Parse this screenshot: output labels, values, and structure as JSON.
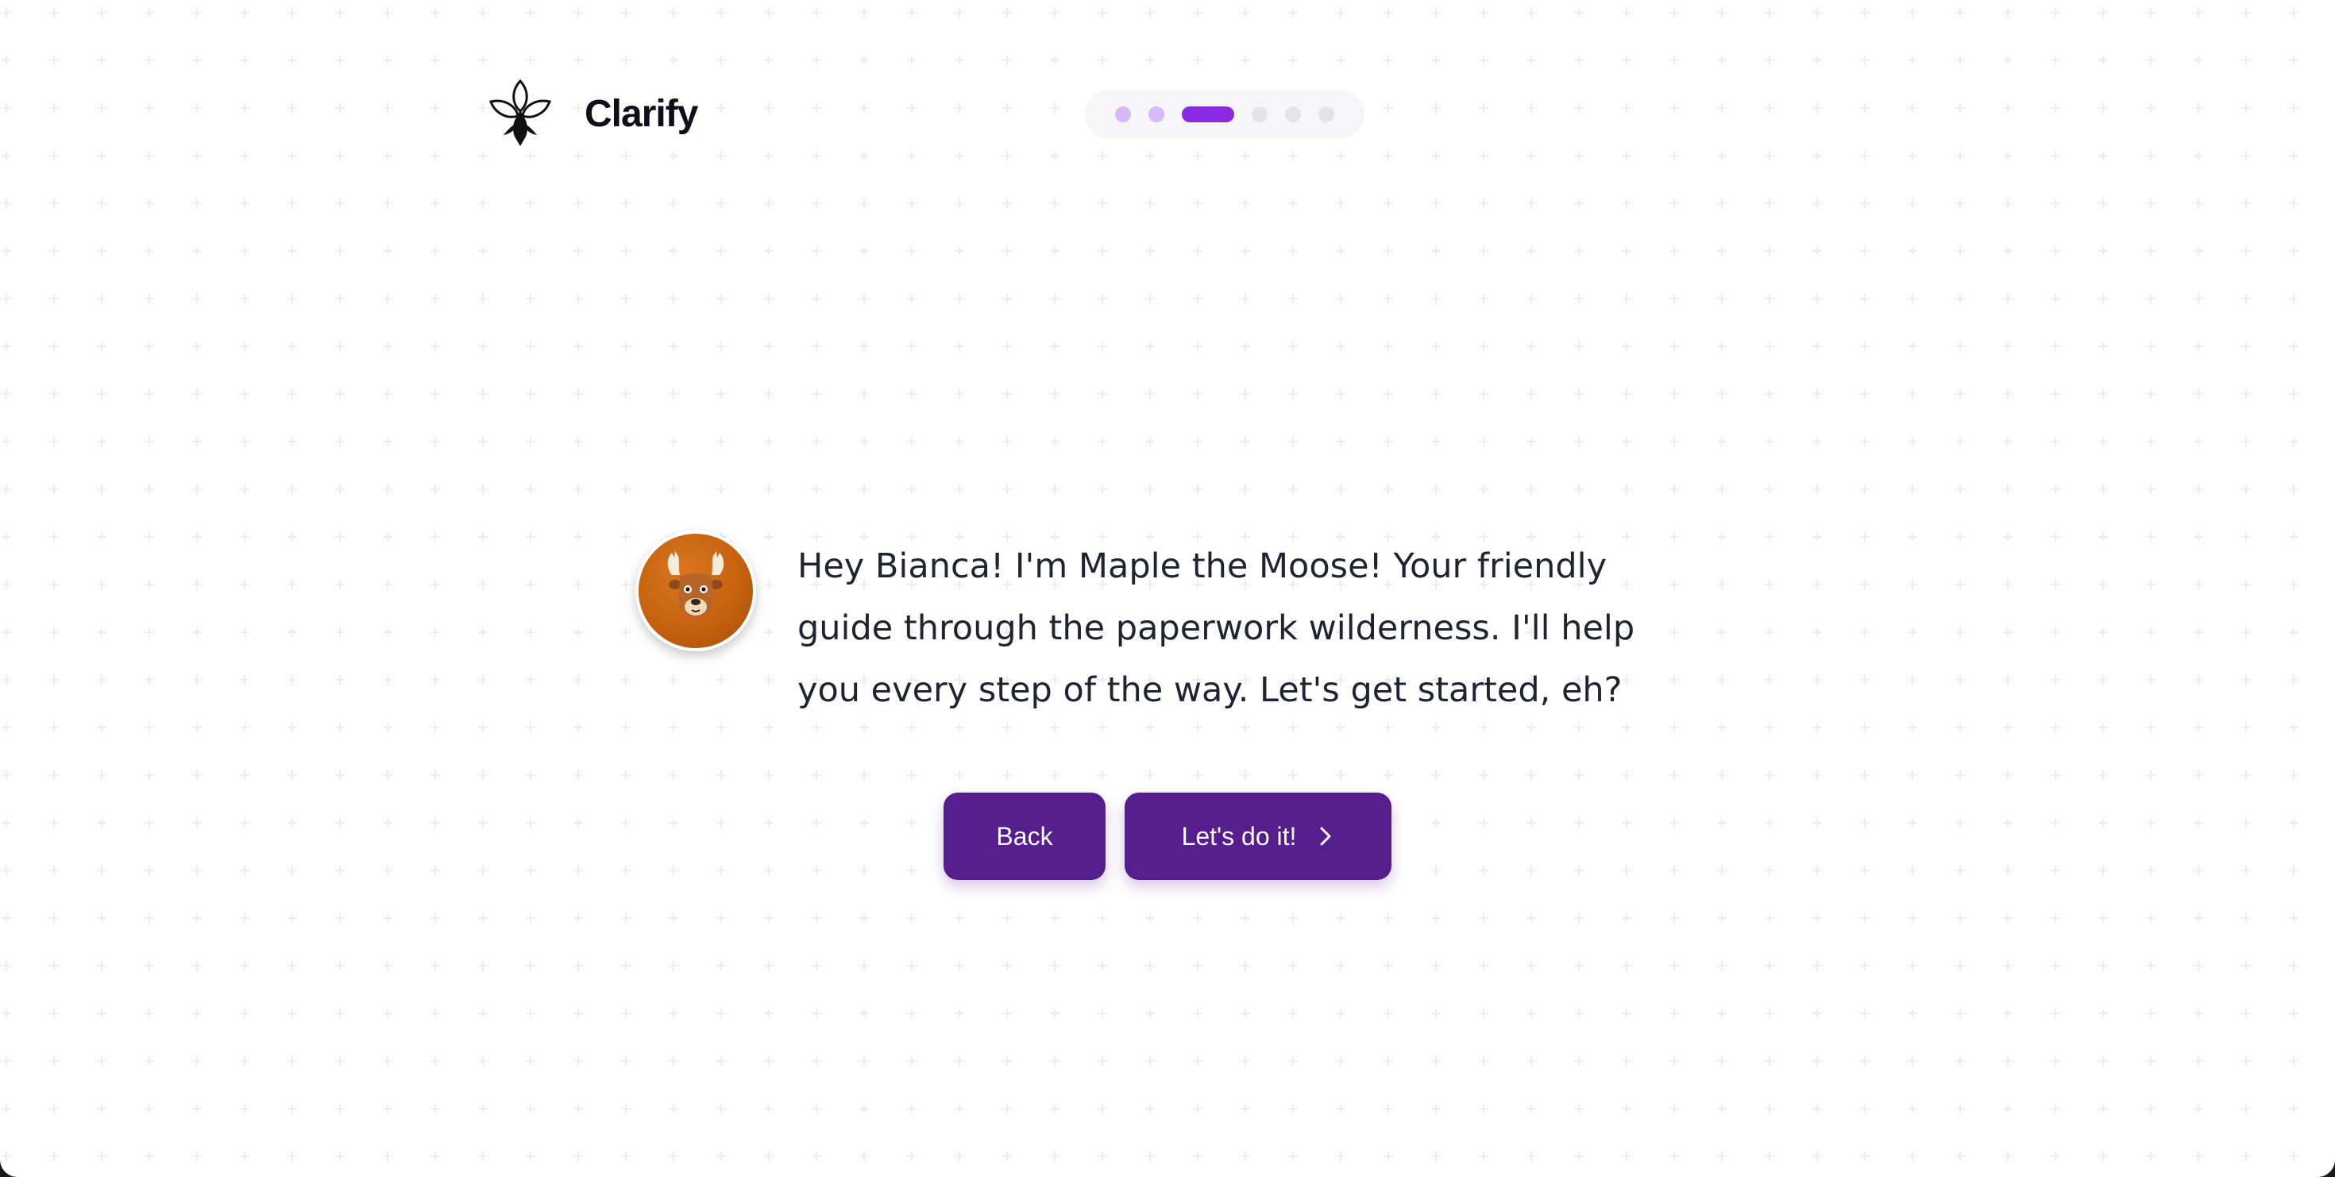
{
  "app": {
    "name": "Clarify",
    "logo_icon": "trillium-flower-logo"
  },
  "stepper": {
    "total_steps": 6,
    "current_step": 3,
    "steps": [
      "done",
      "done",
      "active",
      "todo",
      "todo",
      "todo"
    ]
  },
  "guide": {
    "avatar_icon": "moose-avatar",
    "message": "Hey Bianca! I'm Maple the Moose! Your friendly guide through the paperwork wilderness. I'll help you every step of the way. Let's get started, eh?"
  },
  "actions": {
    "back_label": "Back",
    "next_label": "Let's do it!",
    "next_icon": "chevron-right-icon"
  },
  "colors": {
    "primary_button": "#561d8c",
    "active_step": "#8a2be2",
    "done_step": "#d7b8f8",
    "todo_step": "#e4e3e8",
    "avatar": "#c6620f"
  }
}
